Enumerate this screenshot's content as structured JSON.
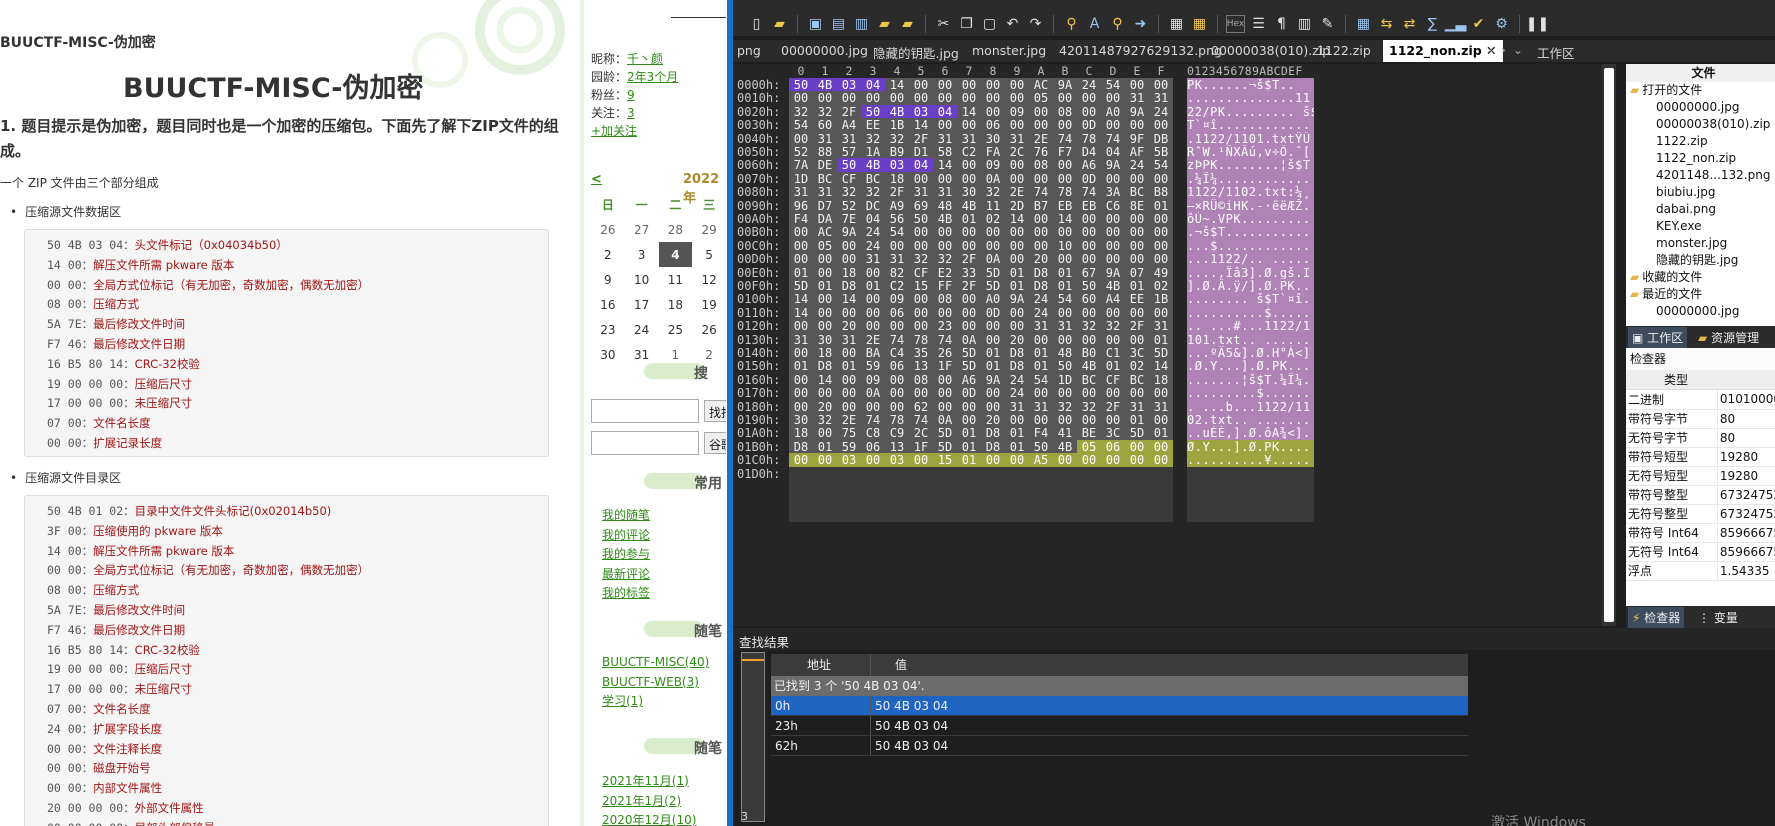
{
  "blog": {
    "crumb": "BUUCTF-MISC-伪加密",
    "title": "BUUCTF-MISC-伪加密",
    "para1": "1. 题目提示是伪加密，题目同时也是一个加密的压缩包。下面先了解下ZIP文件的组成。",
    "para2": "一个 ZIP 文件由三个部分组成",
    "section1": "压缩源文件数据区",
    "section2": "压缩源文件目录区",
    "code1": [
      {
        "hex": "50 4B 03 04：",
        "desc": "头文件标记（0x04034b50）"
      },
      {
        "hex": "14 00：",
        "desc": "解压文件所需 pkware 版本"
      },
      {
        "hex": "00 00：",
        "desc": "全局方式位标记（有无加密，奇数加密，偶数无加密）"
      },
      {
        "hex": "08 00：",
        "desc": "压缩方式"
      },
      {
        "hex": "5A 7E：",
        "desc": "最后修改文件时间"
      },
      {
        "hex": "F7 46：",
        "desc": "最后修改文件日期"
      },
      {
        "hex": "16 B5 80 14：",
        "desc": "CRC-32校验"
      },
      {
        "hex": "19 00 00 00：",
        "desc": "压缩后尺寸"
      },
      {
        "hex": "17 00 00 00：",
        "desc": "未压缩尺寸"
      },
      {
        "hex": "07 00：",
        "desc": "文件名长度"
      },
      {
        "hex": "00 00：",
        "desc": "扩展记录长度"
      }
    ],
    "code2": [
      {
        "hex": "50 4B 01 02：",
        "desc": "目录中文件文件头标记(0x02014b50)"
      },
      {
        "hex": "3F 00：",
        "desc": "压缩使用的 pkware 版本"
      },
      {
        "hex": "14 00：",
        "desc": "解压文件所需 pkware 版本"
      },
      {
        "hex": "00 00：",
        "desc": "全局方式位标记（有无加密，奇数加密，偶数无加密）"
      },
      {
        "hex": "08 00：",
        "desc": "压缩方式"
      },
      {
        "hex": "5A 7E：",
        "desc": "最后修改文件时间"
      },
      {
        "hex": "F7 46：",
        "desc": "最后修改文件日期"
      },
      {
        "hex": "16 B5 80 14：",
        "desc": "CRC-32校验"
      },
      {
        "hex": "19 00 00 00：",
        "desc": "压缩后尺寸"
      },
      {
        "hex": "17 00 00 00：",
        "desc": "未压缩尺寸"
      },
      {
        "hex": "07 00：",
        "desc": "文件名长度"
      },
      {
        "hex": "24 00：",
        "desc": "扩展字段长度"
      },
      {
        "hex": "00 00：",
        "desc": "文件注释长度"
      },
      {
        "hex": "00 00：",
        "desc": "磁盘开始号"
      },
      {
        "hex": "00 00：",
        "desc": "内部文件属性"
      },
      {
        "hex": "20 00 00 00：",
        "desc": "外部文件属性"
      },
      {
        "hex": "00 00 00 00：",
        "desc": "局部头部偏移量"
      }
    ]
  },
  "sidebar": {
    "nickname_label": "昵称：",
    "nickname": "千丶颜",
    "age_label": "园龄：",
    "age": "2年3个月",
    "fans_label": "粉丝：",
    "fans": "9",
    "follow_label": "关注：",
    "follow": "3",
    "add_follow": "+加关注",
    "cal_prev": "<",
    "cal_title": "2022年",
    "weekdays": [
      "日",
      "一",
      "二",
      "三"
    ],
    "weeks": [
      [
        "26",
        "27",
        "28",
        "29"
      ],
      [
        "2",
        "3",
        "4",
        "5"
      ],
      [
        "9",
        "10",
        "11",
        "12"
      ],
      [
        "16",
        "17",
        "18",
        "19"
      ],
      [
        "23",
        "24",
        "25",
        "26"
      ],
      [
        "30",
        "31",
        "1",
        "2"
      ]
    ],
    "search_label": "搜",
    "find_btn": "找找",
    "google_btn": "谷歌",
    "common_label": "常用",
    "common_links": [
      "我的随笔",
      "我的评论",
      "我的参与",
      "最新评论",
      "我的标签"
    ],
    "cat_label": "随笔",
    "categories": [
      "BUUCTF-MISC(40)",
      "BUUCTF-WEB(3)",
      "学习(1)"
    ],
    "archive_label": "随笔",
    "archives": [
      "2021年11月(1)",
      "2021年1月(2)",
      "2020年12月(10)"
    ]
  },
  "hex": {
    "tabs": [
      "png",
      "00000000.jpg",
      "隐藏的钥匙.jpg",
      "monster.jpg",
      "4201148792762913 2.png",
      "00000038(010).zip",
      "1122.zip"
    ],
    "active_tab": "1122_non.zip",
    "workspace_tab": "工作区",
    "col_header": [
      "0",
      "1",
      "2",
      "3",
      "4",
      "5",
      "6",
      "7",
      "8",
      "9",
      "A",
      "B",
      "C",
      "D",
      "E",
      "F"
    ],
    "ascii_header": "0123456789ABCDEF",
    "rows": [
      {
        "addr": "0000h:",
        "bytes": "50 4B 03 04 14 00 00 00 00 00 AC 9A 24 54 00 00",
        "ascii": "PK......¬š$T.."
      },
      {
        "addr": "0010h:",
        "bytes": "00 00 00 00 00 00 00 00 00 00 05 00 00 00 31 31",
        "ascii": "..............11"
      },
      {
        "addr": "0020h:",
        "bytes": "32 32 2F 50 4B 03 04 14 00 09 00 08 00 A0 9A 24",
        "ascii": "22/PK......... š$"
      },
      {
        "addr": "0030h:",
        "bytes": "54 60 A4 EE 1B 14 00 00 06 00 00 00 0D 00 00 00",
        "ascii": "T`¤î............"
      },
      {
        "addr": "0040h:",
        "bytes": "00 31 31 32 32 2F 31 31 30 31 2E 74 78 74 9F DB",
        "ascii": ".1122/1101.txtŸÛ"
      },
      {
        "addr": "0050h:",
        "bytes": "52 88 57 1A B9 D1 58 C2 FA 2C 76 F7 D4 04 AF 5B",
        "ascii": "RˆW.¹ÑXÂú,v÷Ô.¯["
      },
      {
        "addr": "0060h:",
        "bytes": "7A DE 50 4B 03 04 14 00 09 00 08 00 A6 9A 24 54",
        "ascii": "zÞPK........¦š$T"
      },
      {
        "addr": "0070h:",
        "bytes": "1D BC CF BC 18 00 00 00 0A 00 00 00 0D 00 00 00",
        "ascii": ".¼Ï¼............"
      },
      {
        "addr": "0080h:",
        "bytes": "31 31 32 32 2F 31 31 30 32 2E 74 78 74 3A BC B8",
        "ascii": "1122/1102.txt:¼¸"
      },
      {
        "addr": "0090h:",
        "bytes": "96 D7 52 DC A9 69 48 4B 11 2D B7 EB EB C6 8E 01",
        "ascii": "–×RÜ©iHK.-·ëëÆŽ."
      },
      {
        "addr": "00A0h:",
        "bytes": "F4 DA 7E 04 56 50 4B 01 02 14 00 14 00 00 00 00",
        "ascii": "ôÚ~.VPK........."
      },
      {
        "addr": "00B0h:",
        "bytes": "00 AC 9A 24 54 00 00 00 00 00 00 00 00 00 00 00",
        "ascii": ".¬š$T..........."
      },
      {
        "addr": "00C0h:",
        "bytes": "00 05 00 24 00 00 00 00 00 00 00 10 00 00 00 00",
        "ascii": "...$............"
      },
      {
        "addr": "00D0h:",
        "bytes": "00 00 00 31 31 32 32 2F 0A 00 20 00 00 00 00 00",
        "ascii": "...1122/.. ....."
      },
      {
        "addr": "00E0h:",
        "bytes": "01 00 18 00 82 CF E2 33 5D 01 D8 01 67 9A 07 49",
        "ascii": "....‚Ïâ3].Ø.gš.I"
      },
      {
        "addr": "00F0h:",
        "bytes": "5D 01 D8 01 C2 15 FF 2F 5D 01 D8 01 50 4B 01 02",
        "ascii": "].Ø.Â.ÿ/].Ø.PK.."
      },
      {
        "addr": "0100h:",
        "bytes": "14 00 14 00 09 00 08 00 A0 9A 24 54 60 A4 EE 1B",
        "ascii": "........ š$T`¤î."
      },
      {
        "addr": "0110h:",
        "bytes": "14 00 00 00 06 00 00 00 0D 00 24 00 00 00 00 00",
        "ascii": "..........$....."
      },
      {
        "addr": "0120h:",
        "bytes": "00 00 20 00 00 00 23 00 00 00 31 31 32 32 2F 31",
        "ascii": ".. ...#...1122/1"
      },
      {
        "addr": "0130h:",
        "bytes": "31 30 31 2E 74 78 74 0A 00 20 00 00 00 00 00 01",
        "ascii": "101.txt.. ......"
      },
      {
        "addr": "0140h:",
        "bytes": "00 18 00 BA C4 35 26 5D 01 D8 01 48 B0 C1 3C 5D",
        "ascii": "...ºÄ5&].Ø.H°Á<]"
      },
      {
        "addr": "0150h:",
        "bytes": "01 D8 01 59 06 13 1F 5D 01 D8 01 50 4B 01 02 14",
        "ascii": ".Ø.Y...].Ø.PK..."
      },
      {
        "addr": "0160h:",
        "bytes": "00 14 00 09 00 08 00 A6 9A 24 54 1D BC CF BC 18",
        "ascii": ".......¦š$T.¼Ï¼."
      },
      {
        "addr": "0170h:",
        "bytes": "00 00 00 0A 00 00 00 0D 00 24 00 00 00 00 00 00",
        "ascii": ".........$......"
      },
      {
        "addr": "0180h:",
        "bytes": "00 20 00 00 00 62 00 00 00 31 31 32 32 2F 31 31",
        "ascii": ". ...b...1122/11"
      },
      {
        "addr": "0190h:",
        "bytes": "30 32 2E 74 78 74 0A 00 20 00 00 00 00 00 01 00",
        "ascii": "02.txt.. ......."
      },
      {
        "addr": "01A0h:",
        "bytes": "18 00 75 C8 C9 2C 5D 01 D8 01 F4 41 BE 3C 5D 01",
        "ascii": "..uÈÉ,].Ø.ôA¾<]."
      },
      {
        "addr": "01B0h:",
        "bytes": "D8 01 59 06 13 1F 5D 01 D8 01 50 4B 05 06 00 00",
        "ascii": "Ø.Y...].Ø.PK...."
      },
      {
        "addr": "01C0h:",
        "bytes": "00 00 03 00 03 00 15 01 00 00 A5 00 00 00 00 00",
        "ascii": "..........¥....."
      },
      {
        "addr": "01D0h:",
        "bytes": "",
        "ascii": ""
      }
    ],
    "files_header": "文件",
    "open_files": "打开的文件",
    "file_list": [
      "00000000.jpg",
      "00000038(010).zip",
      "1122.zip",
      "1122_non.zip",
      "4201148...132.png",
      "biubiu.jpg",
      "dabai.png",
      "KEY.exe",
      "monster.jpg",
      "隐藏的钥匙.jpg"
    ],
    "favorites": "收藏的文件",
    "recent": "最近的文件",
    "recent_first": "00000000.jpg",
    "panel_tab_workspace": "工作区",
    "panel_tab_resources": "资源管理",
    "inspector_title": "检查器",
    "inspector_col": "类型",
    "inspector_rows": [
      {
        "k": "二进制",
        "v": "01010000"
      },
      {
        "k": "带符号字节",
        "v": "80"
      },
      {
        "k": "无符号字节",
        "v": "80"
      },
      {
        "k": "带符号短型",
        "v": "19280"
      },
      {
        "k": "无符号短型",
        "v": "19280"
      },
      {
        "k": "带符号整型",
        "v": "67324752"
      },
      {
        "k": "无符号整型",
        "v": "67324752"
      },
      {
        "k": "带符号 Int64",
        "v": "85966675"
      },
      {
        "k": "无符号 Int64",
        "v": "85966675"
      },
      {
        "k": "浮点",
        "v": "1.54335"
      }
    ],
    "panel_tab_inspector": "检查器",
    "panel_tab_vars": "变量",
    "find_title": "查找结果",
    "find_col_addr": "地址",
    "find_col_val": "值",
    "find_summary": "已找到 3 个 '50 4B 03 04'.",
    "find_rows": [
      {
        "addr": "0h",
        "val": "50 4B 03 04"
      },
      {
        "addr": "23h",
        "val": "50 4B 03 04"
      },
      {
        "addr": "62h",
        "val": "50 4B 03 04"
      }
    ],
    "find_count": "3",
    "watermark": "激活 Windows"
  }
}
